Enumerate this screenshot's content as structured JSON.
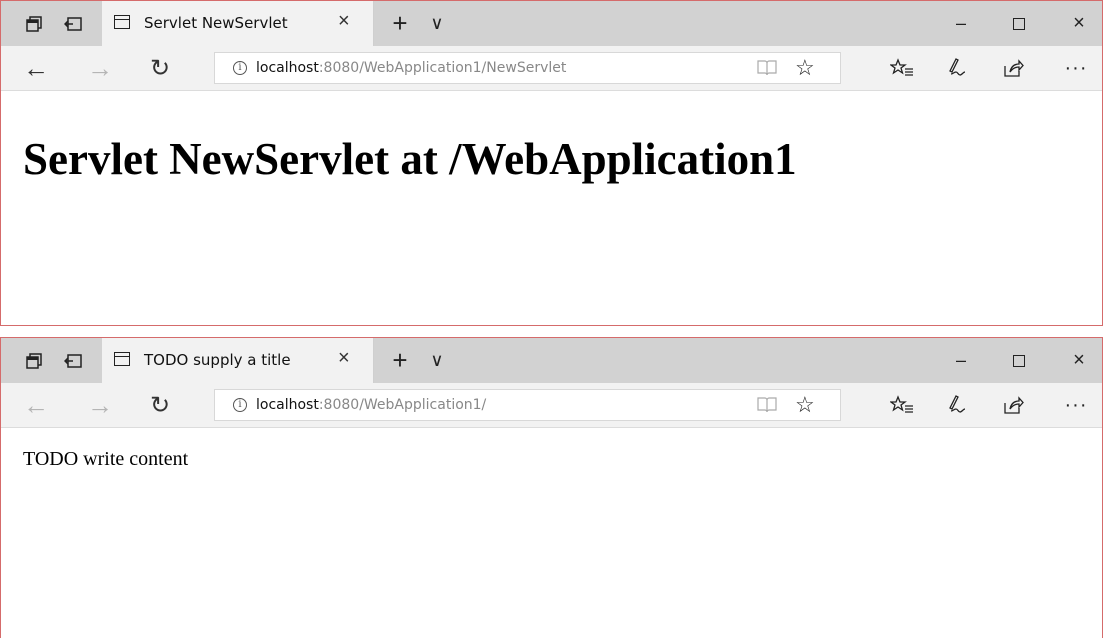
{
  "windows": [
    {
      "tab_title": "Servlet NewServlet",
      "url_host": "localhost",
      "url_path": ":8080/WebApplication1/NewServlet",
      "back_enabled": true,
      "forward_enabled": false,
      "content": {
        "heading": "Servlet NewServlet at /WebApplication1"
      }
    },
    {
      "tab_title": "TODO supply a title",
      "url_host": "localhost",
      "url_path": ":8080/WebApplication1/",
      "back_enabled": false,
      "forward_enabled": false,
      "content": {
        "text": "TODO write content"
      }
    }
  ],
  "icons": {
    "tabs_preview": "tabs-icon",
    "set_aside": "set-aside-tabs-icon",
    "page": "page-icon",
    "close_tab": "close-icon",
    "new_tab": "plus-icon",
    "tab_menu": "chevron-down-icon",
    "minimize": "minimize-icon",
    "maximize": "maximize-icon",
    "close_window": "close-icon",
    "back": "back-arrow-icon",
    "forward": "forward-arrow-icon",
    "refresh": "refresh-icon",
    "info": "info-icon",
    "reading_view": "book-icon",
    "favorite": "star-icon",
    "favorites_list": "favorites-list-icon",
    "web_note": "pen-icon",
    "share": "share-icon",
    "more": "more-icon"
  },
  "glyphs": {
    "close": "×",
    "plus": "+",
    "chevron": "∨",
    "minimize": "–",
    "back": "←",
    "forward": "→",
    "refresh": "↻",
    "info": "i",
    "star": "☆",
    "more": "···"
  },
  "colors": {
    "tabbar_bg": "#d2d2d2",
    "active_tab_bg": "#f2f2f2",
    "window_border": "#d56b6b",
    "url_path": "#888888"
  }
}
